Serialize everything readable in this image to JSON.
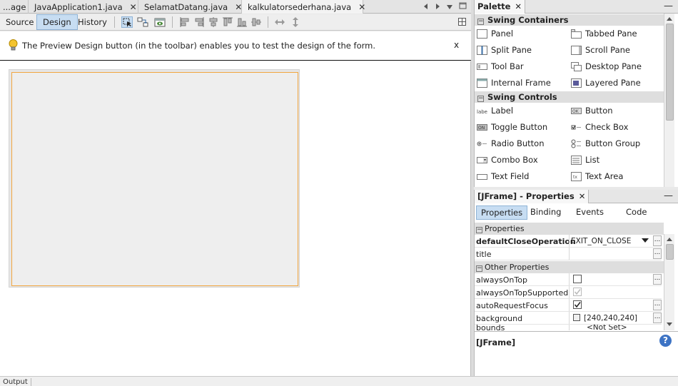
{
  "editor_tabs": [
    {
      "label": "...age",
      "active": false
    },
    {
      "label": "JavaApplication1.java",
      "active": false
    },
    {
      "label": "SelamatDatang.java",
      "active": false
    },
    {
      "label": "kalkulatorsederhana.java",
      "active": true
    }
  ],
  "toolbar": {
    "source_label": "Source",
    "design_label": "Design",
    "history_label": "History"
  },
  "info_bar": {
    "message": "The Preview Design button (in the toolbar) enables you to test the design of the form.",
    "close_label": "x"
  },
  "palette": {
    "title": "Palette",
    "categories": [
      {
        "name": "Swing Containers",
        "items": [
          "Panel",
          "Tabbed Pane",
          "Split Pane",
          "Scroll Pane",
          "Tool Bar",
          "Desktop Pane",
          "Internal Frame",
          "Layered Pane"
        ]
      },
      {
        "name": "Swing Controls",
        "items": [
          "Label",
          "Button",
          "Toggle Button",
          "Check Box",
          "Radio Button",
          "Button Group",
          "Combo Box",
          "List",
          "Text Field",
          "Text Area"
        ]
      }
    ]
  },
  "properties": {
    "title": "[JFrame] - Properties",
    "tabs": [
      "Properties",
      "Binding",
      "Events",
      "Code"
    ],
    "active_tab": "Properties",
    "groups": [
      {
        "name": "Properties",
        "rows": [
          {
            "name": "defaultCloseOperation",
            "value": "EXIT_ON_CLOSE",
            "bold": true,
            "type": "combo"
          },
          {
            "name": "title",
            "value": "",
            "type": "text"
          }
        ]
      },
      {
        "name": "Other Properties",
        "rows": [
          {
            "name": "alwaysOnTop",
            "checked": false,
            "type": "check"
          },
          {
            "name": "alwaysOnTopSupported",
            "checked": true,
            "type": "check-disabled"
          },
          {
            "name": "autoRequestFocus",
            "checked": true,
            "type": "check"
          },
          {
            "name": "background",
            "value": "[240,240,240]",
            "type": "color"
          },
          {
            "name": "bounds",
            "value": "<Not Set>",
            "type": "text"
          }
        ]
      }
    ],
    "description_title": "[JFrame]",
    "help_label": "?"
  },
  "output_tab": "Output"
}
